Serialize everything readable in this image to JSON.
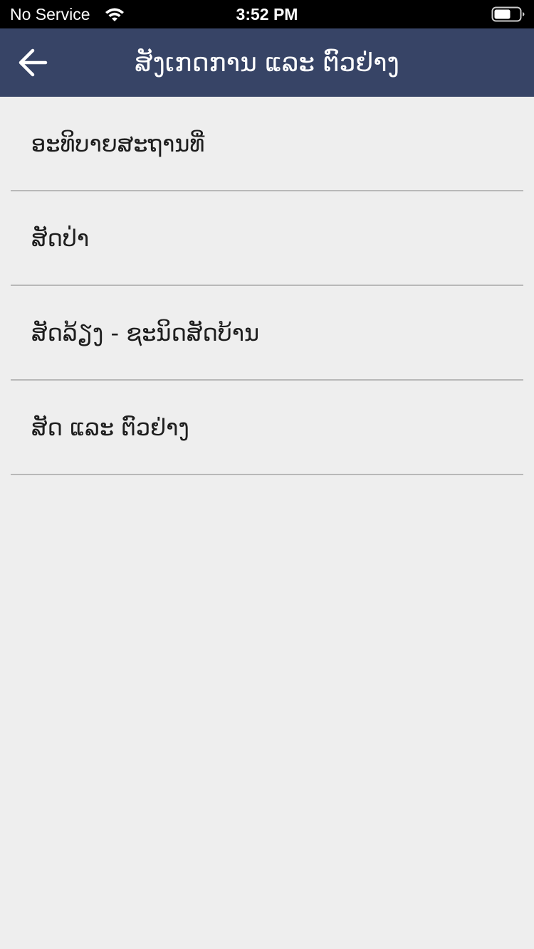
{
  "status_bar": {
    "carrier": "No Service",
    "time": "3:52 PM",
    "wifi_icon": "wifi-icon",
    "battery_icon": "battery-icon"
  },
  "nav": {
    "back_icon": "arrow-left-icon",
    "title": "ສັງເກດການ ແລະ ຕົວຢ່າງ"
  },
  "menu": {
    "items": [
      {
        "label": "ອະທິບາຍສະຖານທີ່"
      },
      {
        "label": "ສັດປ່າ"
      },
      {
        "label": "ສັດລ້ຽງ - ຊະນິດສັດບ້ານ"
      },
      {
        "label": "ສັດ ແລະ ຕົວຢ່າງ"
      }
    ]
  },
  "colors": {
    "status_bar_bg": "#000000",
    "nav_bar_bg": "#374466",
    "page_bg": "#eeeeee",
    "divider": "#b8b8b8",
    "text": "#1e1e1e"
  }
}
